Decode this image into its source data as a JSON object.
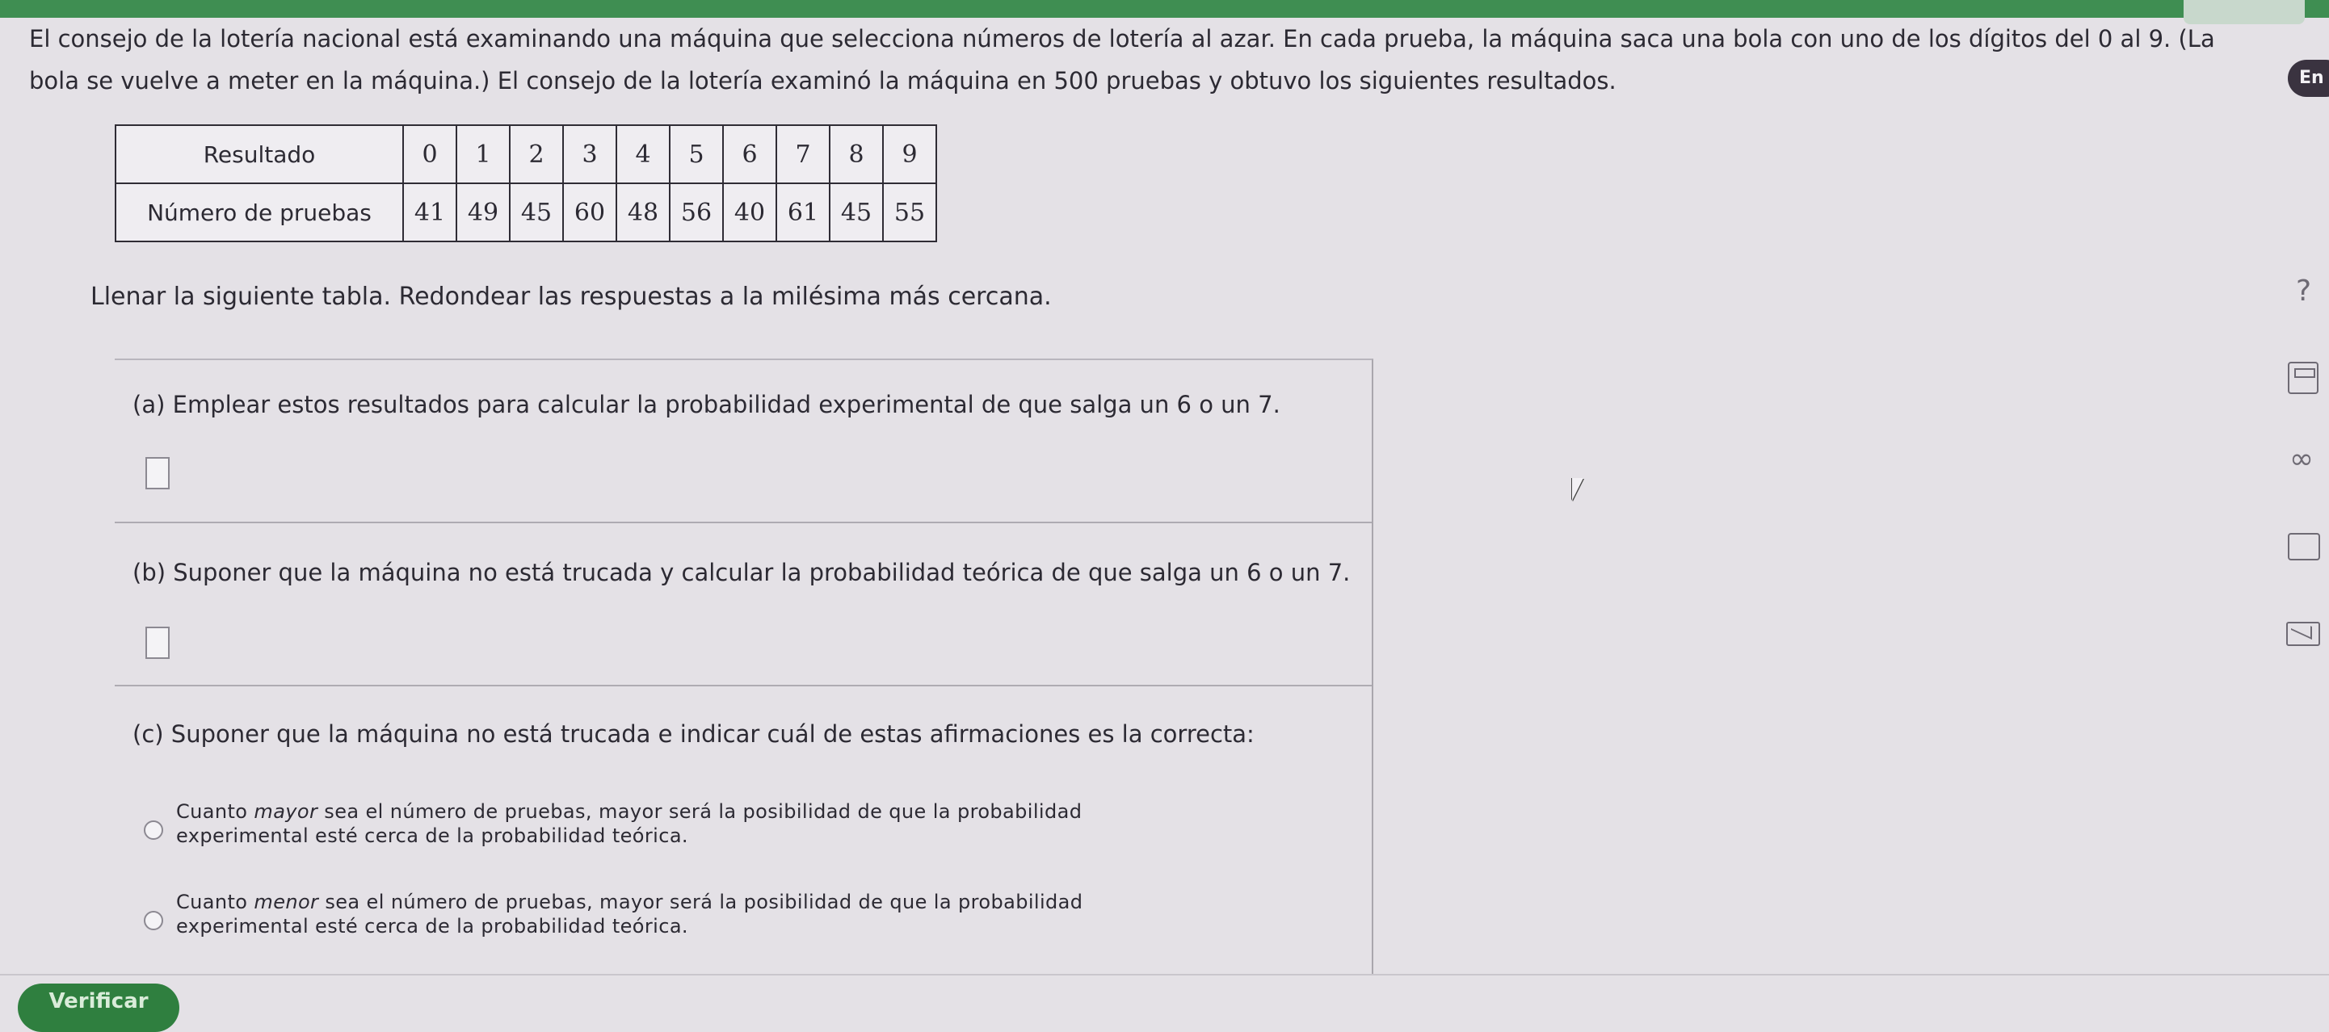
{
  "header": {
    "language_badge": "En"
  },
  "problem": {
    "intro": "El consejo de la lotería nacional está examinando una máquina que selecciona números de lotería al azar. En cada prueba, la máquina saca una bola con uno de los dígitos del 0 al 9. (La bola se vuelve a meter en la máquina.) El consejo de la lotería examinó la máquina en 500 pruebas y obtuvo los siguientes resultados.",
    "table": {
      "row_labels": [
        "Resultado",
        "Número de pruebas"
      ],
      "outcomes": [
        "0",
        "1",
        "2",
        "3",
        "4",
        "5",
        "6",
        "7",
        "8",
        "9"
      ],
      "counts": [
        "41",
        "49",
        "45",
        "60",
        "48",
        "56",
        "40",
        "61",
        "45",
        "55"
      ]
    },
    "instruction": "Llenar la siguiente tabla. Redondear las respuestas a la milésima más cercana."
  },
  "questions": {
    "a": {
      "text": "(a) Emplear estos resultados para calcular la probabilidad experimental de que salga un 6 o un 7.",
      "answer": ""
    },
    "b": {
      "text": "(b) Suponer que la máquina no está trucada y calcular la probabilidad teórica de que salga un 6 o un 7.",
      "answer": ""
    },
    "c": {
      "text": "(c) Suponer que la máquina no está trucada e indicar cuál de estas afirmaciones es la correcta:",
      "options": [
        {
          "pre": "Cuanto ",
          "em": "mayor",
          "line1_rest": " sea el número de pruebas, mayor será la posibilidad de que la probabilidad",
          "line2": "experimental esté cerca de la probabilidad teórica."
        },
        {
          "pre": "Cuanto ",
          "em": "menor",
          "line1_rest": " sea el número de pruebas, mayor será la posibilidad de que la probabilidad",
          "line2": "experimental esté cerca de la probabilidad teórica."
        }
      ]
    }
  },
  "sidebar": {
    "help": "?",
    "infinity": "∞"
  },
  "footer": {
    "verify_label": "Verificar"
  }
}
